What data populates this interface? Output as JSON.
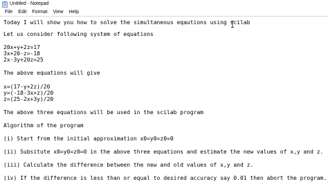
{
  "window": {
    "title": "Untitled - Notepad"
  },
  "menu": {
    "items": [
      "File",
      "Edit",
      "Format",
      "View",
      "Help"
    ]
  },
  "editor": {
    "lines": [
      "Today I will show you how to solve the simultaneous eqautions using scilab",
      "Let us consider following system of equations",
      "20x+y+2z=17",
      "3x+20-z=-18",
      "2x-3y+20z=25",
      "The above equations will give",
      "x=(17-y+2z)/20",
      "y=(-18-3x+z)/20",
      "z=(25-2x+3y)/20",
      "The above three equations will be used in the scilab program",
      "Algorithm of the program",
      "(i) Start from the initial approximation x0=y0=z0=0",
      "(ii) Subsitute x0=y0=z0=0 in the above three equations and estimate the new values of x,y and z.",
      "(iii) Calculate the difference between the new and old values of x,y and z.",
      "(iv) If the difference is less than or equal to desired accuracy say 0.01 then abort the program."
    ]
  },
  "icons": {
    "app": "notepad-icon",
    "cursor": "text-cursor-icon"
  }
}
